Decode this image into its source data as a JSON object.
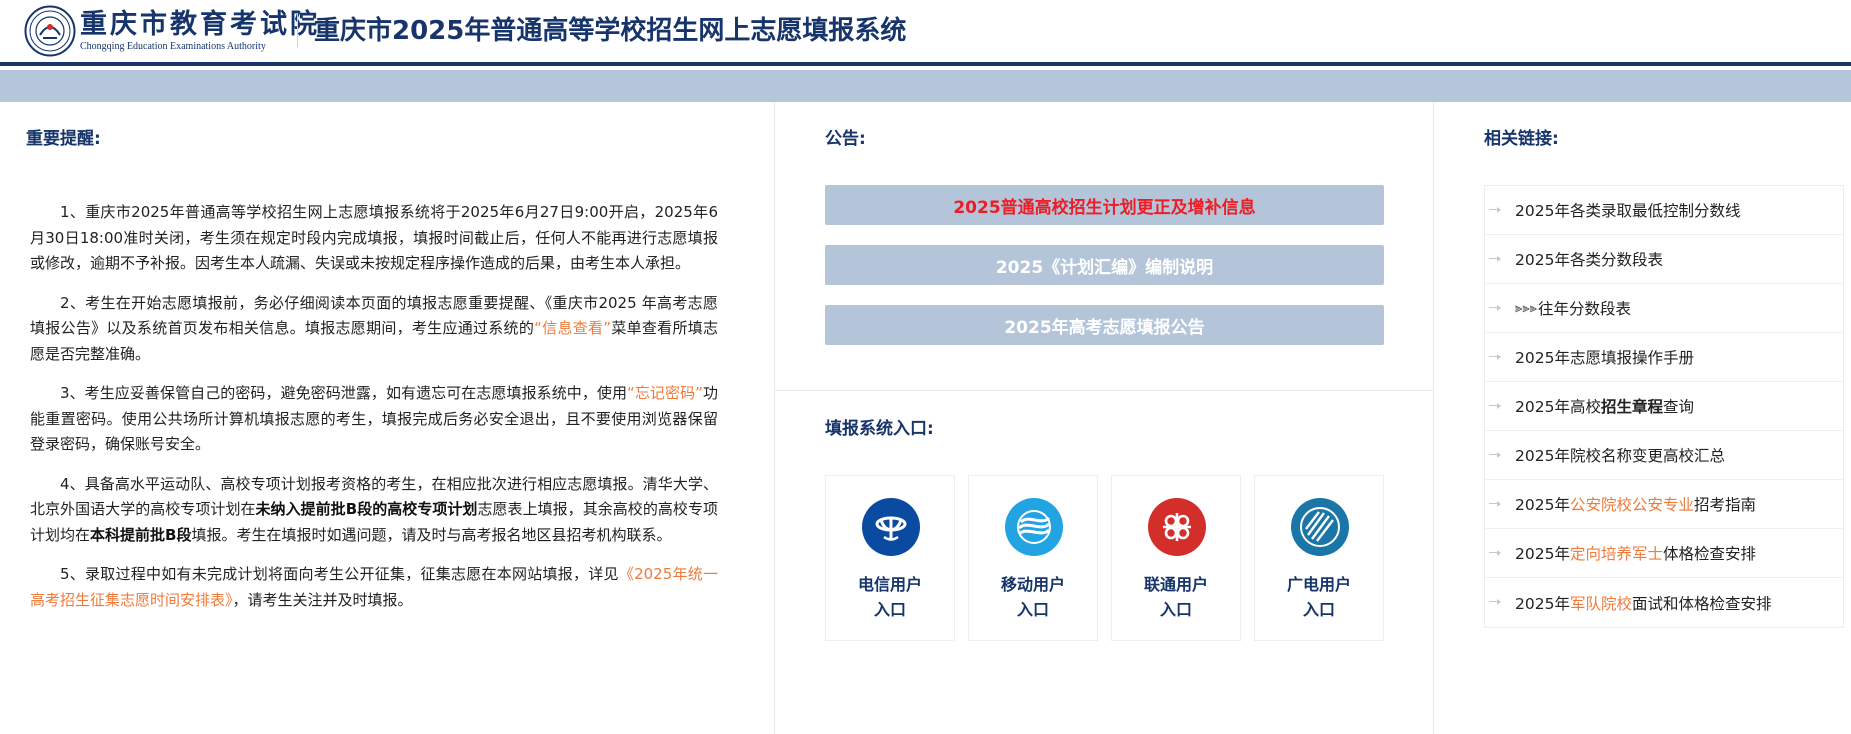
{
  "header": {
    "logo_cn": "重庆市教育考试院",
    "logo_en": "Chongqing Education Examinations Authority",
    "title": "重庆市2025年普通高等学校招生网上志愿填报系统",
    "brand_color": "#17356b"
  },
  "left": {
    "title": "重要提醒:",
    "paragraphs": {
      "p1": "1、重庆市2025年普通高等学校招生网上志愿填报系统将于2025年6月27日9:00开启，2025年6月30日18:00准时关闭，考生须在规定时段内完成填报，填报时间截止后，任何人不能再进行志愿填报或修改，逾期不予补报。因考生本人疏漏、失误或未按规定程序操作造成的后果，由考生本人承担。",
      "p2a": "2、考生在开始志愿填报前，务必仔细阅读本页面的填报志愿重要提醒、《重庆市2025 年高考志愿填报公告》以及系统首页发布相关信息。填报志愿期间，考生应通过系统的",
      "p2_hl": "“信息查看”",
      "p2b": "菜单查看所填志愿是否完整准确。",
      "p3a": "3、考生应妥善保管自己的密码，避免密码泄露，如有遗忘可在志愿填报系统中，使用",
      "p3_hl": "“忘记密码”",
      "p3b": "功能重置密码。使用公共场所计算机填报志愿的考生，填报完成后务必安全退出，且不要使用浏览器保留登录密码，确保账号安全。",
      "p4a": "4、具备高水平运动队、高校专项计划报考资格的考生，在相应批次进行相应志愿填报。清华大学、北京外国语大学的高校专项计划在",
      "p4_b1": "未纳入提前批B段的高校专项计划",
      "p4b": "志愿表上填报，其余高校的高校专项计划均在",
      "p4_b2": "本科提前批B段",
      "p4c": "填报。考生在填报时如遇问题，请及时与高考报名地区县招考机构联系。",
      "p5a": "5、录取过程中如有未完成计划将面向考生公开征集，征集志愿在本网站填报，详见",
      "p5_hl": "《2025年统一高考招生征集志愿时间安排表》",
      "p5b": "，请考生关注并及时填报。"
    },
    "highlight_color": "#f07a3a"
  },
  "middle": {
    "notice_title": "公告:",
    "announcements": [
      {
        "label": "2025普通高校招生计划更正及增补信息",
        "color": "#ee1c25"
      },
      {
        "label": "2025《计划汇编》编制说明",
        "color": "#ffffff"
      },
      {
        "label": "2025年高考志愿填报公告",
        "color": "#ffffff"
      }
    ],
    "entry_title": "填报系统入口:",
    "entries": [
      {
        "line1": "电信用户",
        "line2": "入口",
        "color": "#0a4aa0",
        "icon": "china-telecom-icon"
      },
      {
        "line1": "移动用户",
        "line2": "入口",
        "color": "#22a4e2",
        "icon": "china-mobile-icon"
      },
      {
        "line1": "联通用户",
        "line2": "入口",
        "color": "#d42e2b",
        "icon": "china-unicom-icon"
      },
      {
        "line1": "广电用户",
        "line2": "入口",
        "color": "#1a76a8",
        "icon": "china-broadnet-icon"
      }
    ]
  },
  "right": {
    "title": "相关链接:",
    "links": {
      "l1": "2025年各类录取最低控制分数线",
      "l2": "2025年各类分数段表",
      "l3_tri": "⫸⫸⫸",
      "l3": "往年分数段表",
      "l4": "2025年志愿填报操作手册",
      "l5a": "2025年高校",
      "l5_b": "招生章程",
      "l5b": "查询",
      "l6": "2025年院校名称变更高校汇总",
      "l7a": "2025年",
      "l7_hl": "公安院校公安专业",
      "l7b": "招考指南",
      "l8a": "2025年",
      "l8_hl": "定向培养军士",
      "l8b": "体格检查安排",
      "l9a": "2025年",
      "l9_hl": "军队院校",
      "l9b": "面试和体格检查安排"
    }
  }
}
